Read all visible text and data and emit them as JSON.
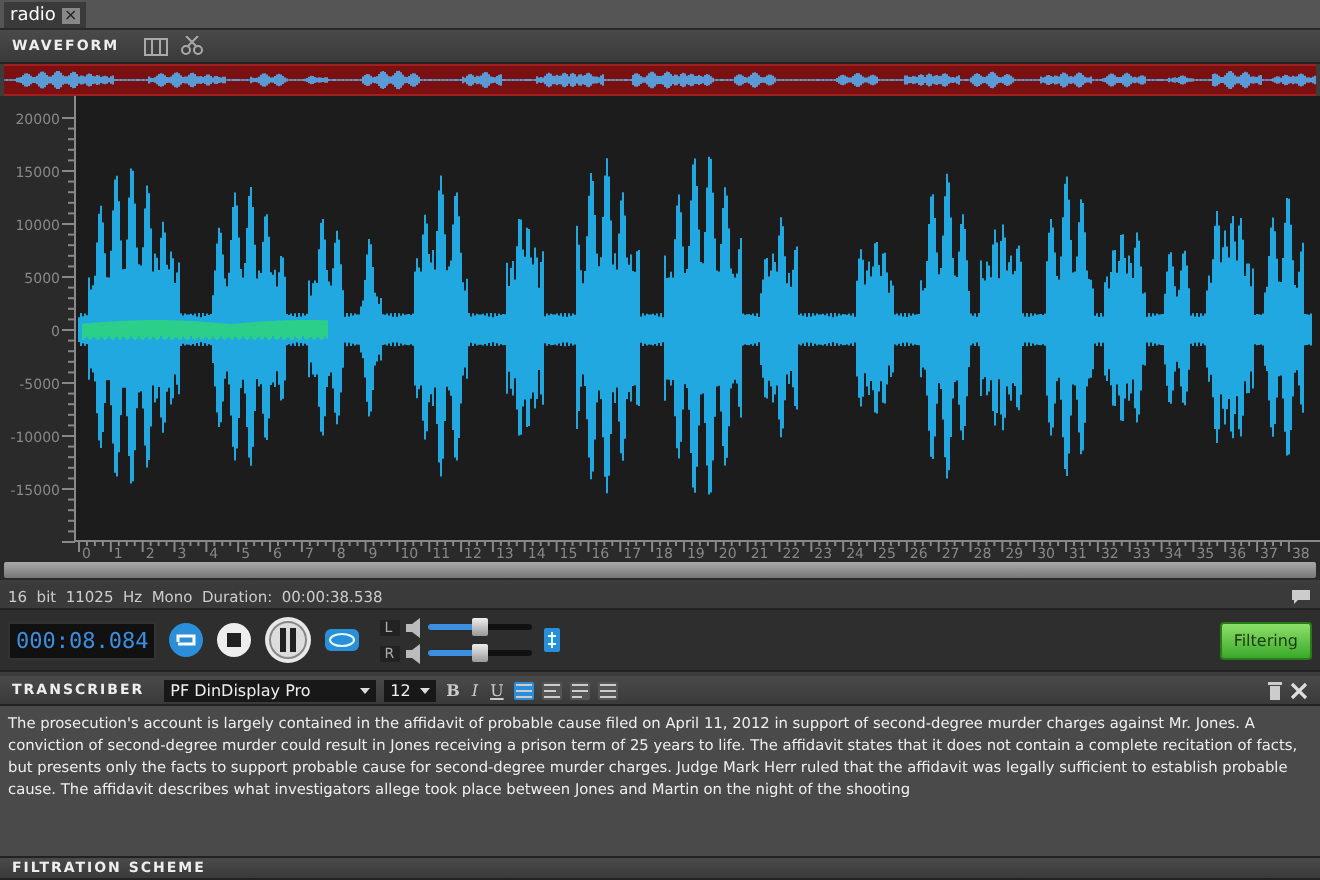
{
  "tabs": [
    {
      "label": "radio",
      "selected": true,
      "close": "×"
    }
  ],
  "waveform_panel": {
    "title": "WAVEFORM",
    "y_axis_labels": [
      "20000",
      "15000",
      "10000",
      "5000",
      "0",
      "-5000",
      "-10000",
      "-15000"
    ],
    "x_axis_labels": [
      "0",
      "1",
      "2",
      "3",
      "4",
      "5",
      "6",
      "7",
      "8",
      "9",
      "10",
      "11",
      "12",
      "13",
      "14",
      "15",
      "16",
      "17",
      "18",
      "19",
      "20",
      "21",
      "22",
      "23",
      "24",
      "25",
      "26",
      "27",
      "28",
      "29",
      "30",
      "31",
      "32",
      "33",
      "34",
      "35",
      "36",
      "37",
      "38"
    ]
  },
  "info_bar": {
    "text": "16  bit  11025  Hz  Mono  Duration:  00:00:38.538"
  },
  "transport": {
    "time": "000:08.084",
    "channels": [
      {
        "label": "L",
        "level": 0.5
      },
      {
        "label": "R",
        "level": 0.5
      }
    ],
    "filter_button": {
      "label": "Filtering",
      "on": true
    }
  },
  "transcriber": {
    "title": "TRANSCRIBER",
    "font": "PF DinDisplay Pro",
    "size": "12",
    "format_buttons": [
      "B",
      "I",
      "U"
    ],
    "align_buttons": [
      {
        "selected": true
      },
      {
        "selected": false
      },
      {
        "selected": false
      },
      {
        "selected": false
      }
    ],
    "text": "The prosecution's account is largely contained in the affidavit of probable cause filed on April 11, 2012 in support of second-degree murder charges against Mr. Jones. A conviction of second-degree murder could result in Jones receiving a prison term of 25 years to life. The affidavit states that it does not contain a complete recitation of facts, but presents only the facts to support probable cause for second-degree murder charges. Judge Mark Herr ruled that the affidavit was legally sufficient to establish probable cause. The affidavit describes what investigators allege took place between Jones and Martin on the night of the shooting"
  },
  "filtration_panel": {
    "title": "FILTRATION SCHEME"
  }
}
